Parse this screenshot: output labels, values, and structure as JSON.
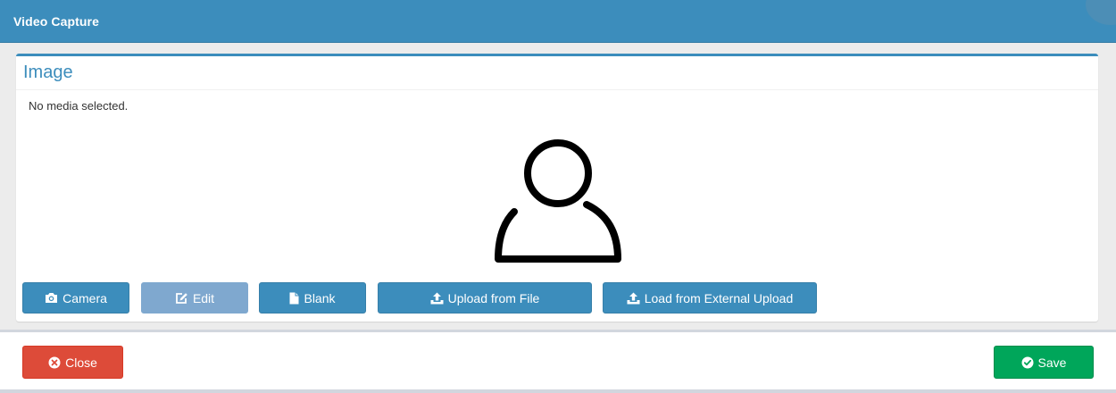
{
  "header": {
    "title": "Video Capture"
  },
  "panel": {
    "title": "Image",
    "status": "No media selected."
  },
  "toolbar": {
    "camera_label": "Camera",
    "edit_label": "Edit",
    "blank_label": "Blank",
    "upload_file_label": "Upload from File",
    "external_upload_label": "Load from External Upload"
  },
  "footer": {
    "close_label": "Close",
    "save_label": "Save"
  },
  "colors": {
    "primary": "#3c8dbc",
    "disabled": "#7fa8cf",
    "danger": "#dd4b39",
    "success": "#00a65a"
  },
  "icons": [
    "camera-icon",
    "edit-icon",
    "file-icon",
    "upload-icon",
    "user-avatar-icon",
    "close-circle-icon",
    "check-circle-icon"
  ]
}
